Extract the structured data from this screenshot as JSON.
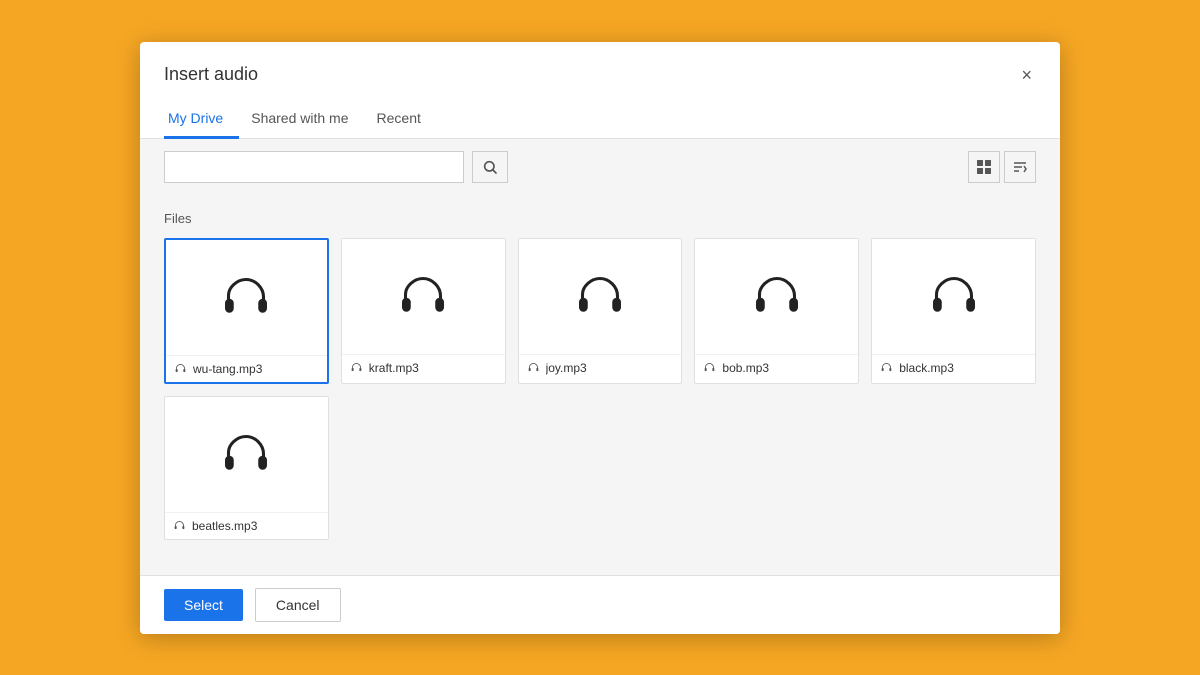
{
  "dialog": {
    "title": "Insert audio",
    "close_label": "×"
  },
  "tabs": [
    {
      "id": "my-drive",
      "label": "My Drive",
      "active": true
    },
    {
      "id": "shared-with-me",
      "label": "Shared with me",
      "active": false
    },
    {
      "id": "recent",
      "label": "Recent",
      "active": false
    }
  ],
  "toolbar": {
    "search_placeholder": "",
    "search_icon": "🔍",
    "grid_view_icon": "▦",
    "sort_icon": "⇅"
  },
  "content": {
    "section_label": "Files",
    "files_row1": [
      {
        "name": "wu-tang.mp3",
        "selected": true
      },
      {
        "name": "kraft.mp3",
        "selected": false
      },
      {
        "name": "joy.mp3",
        "selected": false
      },
      {
        "name": "bob.mp3",
        "selected": false
      },
      {
        "name": "black.mp3",
        "selected": false
      }
    ],
    "files_row2": [
      {
        "name": "beatles.mp3",
        "selected": false
      }
    ]
  },
  "footer": {
    "select_label": "Select",
    "cancel_label": "Cancel"
  }
}
